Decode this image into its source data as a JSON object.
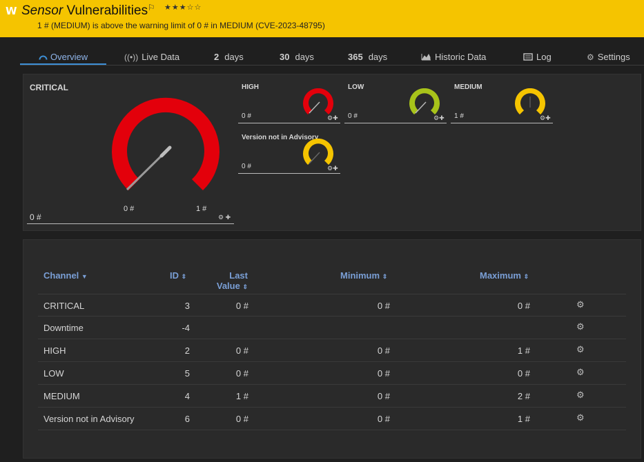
{
  "header": {
    "logo": "W",
    "title_type": "Sensor",
    "title_name": "Vulnerabilities",
    "flag": "⚐",
    "stars": "★★★☆☆",
    "status": "1 # (MEDIUM) is above the warning limit of 0 # in MEDIUM (CVE-2023-48795)",
    "color": "#f5c400"
  },
  "tabs": {
    "overview": "Overview",
    "live_data": "Live Data",
    "days2_num": "2",
    "days2_unit": "days",
    "days30_num": "30",
    "days30_unit": "days",
    "days365_num": "365",
    "days365_unit": "days",
    "historic": "Historic Data",
    "log": "Log",
    "settings": "Settings"
  },
  "gauges": {
    "critical": {
      "label": "CRITICAL",
      "value": "0 #",
      "min": "0 #",
      "max": "1 #",
      "color": "#e3000b",
      "fraction": 0.0
    },
    "high": {
      "label": "HIGH",
      "value": "0 #",
      "color": "#e3000b"
    },
    "low": {
      "label": "LOW",
      "value": "0 #",
      "color": "#a8c31a"
    },
    "medium": {
      "label": "MEDIUM",
      "value": "1 #",
      "color": "#f5c400"
    },
    "version": {
      "label": "Version not in Advisory",
      "value": "0 #",
      "color": "#f5c400"
    }
  },
  "table": {
    "headers": {
      "channel": "Channel",
      "id": "ID",
      "last_line1": "Last",
      "last_line2": "Value",
      "minimum": "Minimum",
      "maximum": "Maximum"
    },
    "rows": [
      {
        "channel": "CRITICAL",
        "id": "3",
        "last": "0 #",
        "min": "0 #",
        "max": "0 #"
      },
      {
        "channel": "Downtime",
        "id": "-4",
        "last": "",
        "min": "",
        "max": ""
      },
      {
        "channel": "HIGH",
        "id": "2",
        "last": "0 #",
        "min": "0 #",
        "max": "1 #"
      },
      {
        "channel": "LOW",
        "id": "5",
        "last": "0 #",
        "min": "0 #",
        "max": "0 #"
      },
      {
        "channel": "MEDIUM",
        "id": "4",
        "last": "1 #",
        "min": "0 #",
        "max": "2 #"
      },
      {
        "channel": "Version not in Advisory",
        "id": "6",
        "last": "0 #",
        "min": "0 #",
        "max": "1 #"
      }
    ]
  }
}
